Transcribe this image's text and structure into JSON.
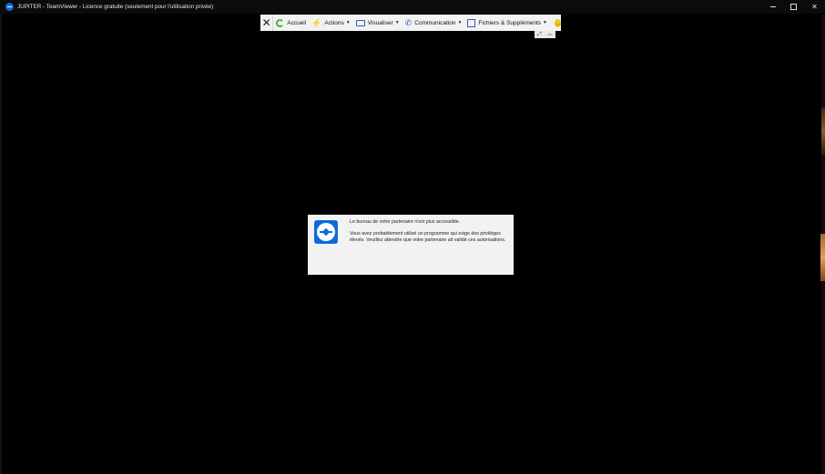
{
  "window": {
    "title": "JUPITER - TeamViewer - Licence gratuite (seulement pour l'utilisation privée)",
    "controls": {
      "minimize": "minimize-icon",
      "maximize": "maximize-icon",
      "close": "close-icon"
    }
  },
  "toolbar": {
    "close_icon": "close-icon",
    "items": [
      {
        "label": "Accueil",
        "icon": "home-icon",
        "dropdown": false
      },
      {
        "label": "Actions",
        "icon": "lightning-icon",
        "dropdown": true
      },
      {
        "label": "Visualiser",
        "icon": "monitor-icon",
        "dropdown": true
      },
      {
        "label": "Communication",
        "icon": "phone-icon",
        "dropdown": true
      },
      {
        "label": "Fichiers & Suppléments",
        "icon": "files-icon",
        "dropdown": true
      }
    ],
    "feedback_icon": "smiley-icon",
    "mini_controls": [
      "fullscreen-icon",
      "collapse-icon"
    ]
  },
  "dialog": {
    "title": "Le bureau de votre partenaire n'est plus accessible.",
    "body": "Vous avez probablement utilisé un programme qui exige des privilèges élevés. Veuillez attendre que votre partenaire ait validé ces autorisations.",
    "logo": "teamviewer-logo"
  },
  "colors": {
    "background": "#000000",
    "toolbar": "#f2f2f2",
    "dialog": "#f2f2f2",
    "brand_blue": "#0e6ad9"
  }
}
